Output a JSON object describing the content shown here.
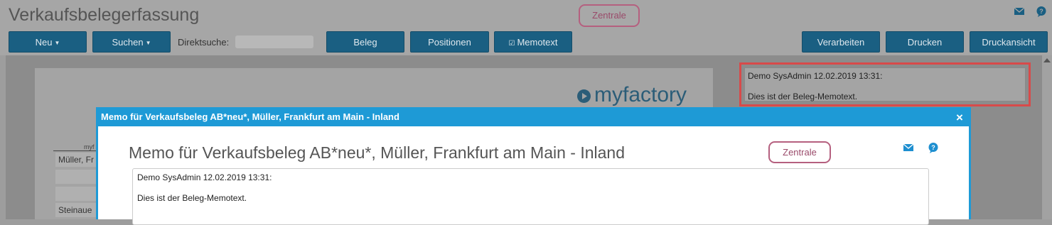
{
  "page": {
    "title": "Verkaufsbelegerfassung",
    "center_badge": "Zentrale"
  },
  "toolbar": {
    "neu_label": "Neu",
    "suchen_label": "Suchen",
    "direktsuche_label": "Direktsuche:",
    "direktsuche_value": "",
    "beleg_label": "Beleg",
    "positionen_label": "Positionen",
    "memotext_label": "Memotext",
    "verarbeiten_label": "Verarbeiten",
    "drucken_label": "Drucken",
    "druckansicht_label": "Druckansicht"
  },
  "document": {
    "logo_text": "myfactory",
    "address_header": "myf",
    "address_lines": [
      "Müller, Fr",
      "",
      "",
      "Steinaue"
    ]
  },
  "memo_preview": {
    "line1": "Demo SysAdmin 12.02.2019 13:31:",
    "line2": "Dies ist der Beleg-Memotext."
  },
  "modal": {
    "title": "Memo für Verkaufsbeleg AB*neu*, Müller, Frankfurt am Main - Inland",
    "heading": "Memo für Verkaufsbeleg AB*neu*, Müller, Frankfurt am Main - Inland",
    "badge": "Zentrale",
    "close_glyph": "×",
    "memo_line1": "Demo SysAdmin 12.02.2019 13:31:",
    "memo_line2": "Dies ist der Beleg-Memotext."
  },
  "icons": {
    "mail": "mail-icon",
    "help": "help-icon",
    "logo": "play-circle-icon"
  },
  "colors": {
    "button_bg": "#1a5f82",
    "modal_accent": "#1e9ad6",
    "badge_border": "#b5607f",
    "highlight_border": "#d84a4a"
  }
}
